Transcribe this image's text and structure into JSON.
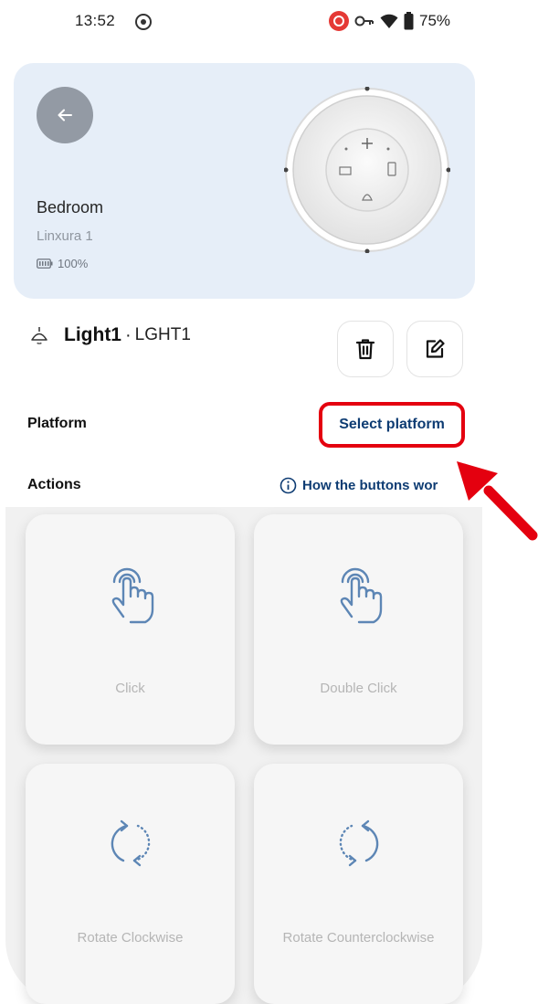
{
  "status_bar": {
    "time": "13:52",
    "battery": "75%"
  },
  "device": {
    "room": "Bedroom",
    "name": "Linxura 1",
    "battery": "100%"
  },
  "button": {
    "name": "Light1",
    "separator": "·",
    "code": "LGHT1"
  },
  "platform": {
    "label": "Platform",
    "action": "Select platform"
  },
  "actions": {
    "label": "Actions",
    "help_link": "How the buttons wor",
    "items": [
      {
        "label": "Click"
      },
      {
        "label": "Double Click"
      },
      {
        "label": "Rotate Clockwise"
      },
      {
        "label": "Rotate Counterclockwise"
      }
    ]
  },
  "colors": {
    "card_bg": "#e6eef8",
    "link": "#0e3c73",
    "highlight": "#e4000f",
    "icon_blue": "#5d86b5"
  },
  "icons": {
    "back": "arrow-left-icon",
    "battery": "battery-icon",
    "lamp": "ceiling-lamp-icon",
    "delete": "trash-icon",
    "edit": "pencil-square-icon",
    "info": "info-circle-icon",
    "touch": "hand-touch-icon",
    "rotate_cw": "rotate-clockwise-icon",
    "rotate_ccw": "rotate-counterclockwise-icon"
  }
}
